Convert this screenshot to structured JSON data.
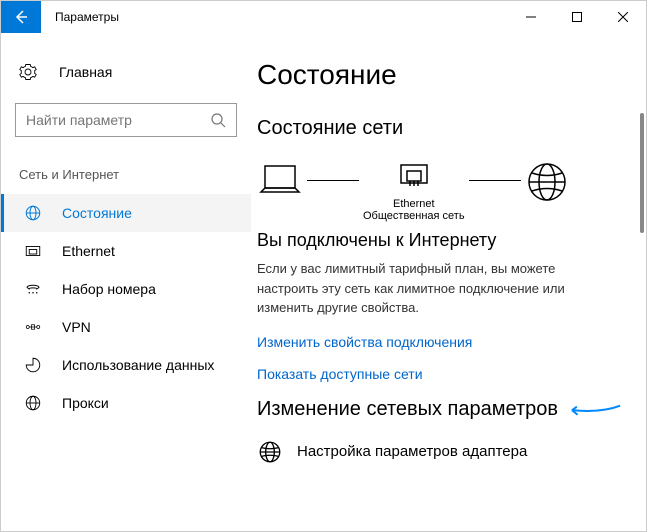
{
  "window": {
    "title": "Параметры"
  },
  "sidebar": {
    "home": "Главная",
    "search_placeholder": "Найти параметр",
    "section": "Сеть и Интернет",
    "items": [
      {
        "label": "Состояние"
      },
      {
        "label": "Ethernet"
      },
      {
        "label": "Набор номера"
      },
      {
        "label": "VPN"
      },
      {
        "label": "Использование данных"
      },
      {
        "label": "Прокси"
      }
    ]
  },
  "main": {
    "heading": "Состояние",
    "network_status_heading": "Состояние сети",
    "diagram": {
      "connection": "Ethernet",
      "profile": "Общественная сеть"
    },
    "connected_title": "Вы подключены к Интернету",
    "connected_desc": "Если у вас лимитный тарифный план, вы можете настроить эту сеть как лимитное подключение или изменить другие свойства.",
    "link_properties": "Изменить свойства подключения",
    "link_networks": "Показать доступные сети",
    "change_params_heading": "Изменение сетевых параметров",
    "adapter_settings": "Настройка параметров адаптера"
  }
}
